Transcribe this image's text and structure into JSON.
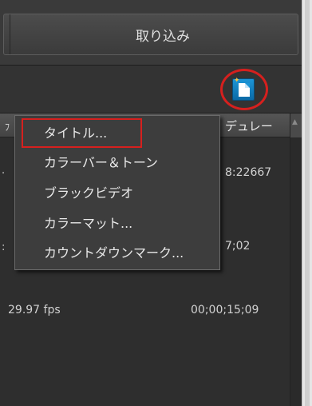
{
  "toolbar": {
    "import_label": "取り込み"
  },
  "panel": {
    "new_item_icon": "new-item-icon",
    "column_header": {
      "duration_label": "デュレー"
    },
    "rows": [
      {
        "duration": "8:22667"
      },
      {
        "duration": "7;02"
      },
      {
        "frame_rate": "29.97 fps",
        "duration": "00;00;15;09"
      }
    ]
  },
  "context_menu": {
    "items": [
      "タイトル...",
      "カラーバー＆トーン",
      "ブラックビデオ",
      "カラーマット...",
      "カウントダウンマーク..."
    ]
  },
  "colors": {
    "highlight": "#d6201e",
    "icon_blue": "#1d95d6"
  }
}
